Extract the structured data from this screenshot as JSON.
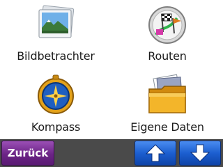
{
  "menu": {
    "items": [
      {
        "label": "Bildbetrachter",
        "icon": "photo-viewer-icon"
      },
      {
        "label": "Routen",
        "icon": "routes-icon"
      },
      {
        "label": "Kompass",
        "icon": "compass-icon"
      },
      {
        "label": "Eigene Daten",
        "icon": "my-data-folder-icon"
      }
    ]
  },
  "toolbar": {
    "back_label": "Zurück",
    "scroll_up_icon": "arrow-up-icon",
    "scroll_down_icon": "arrow-down-icon"
  },
  "colors": {
    "back_button": "#6b2486",
    "nav_button": "#1c5fd0",
    "bottom_bar": "#4a4a4a"
  }
}
